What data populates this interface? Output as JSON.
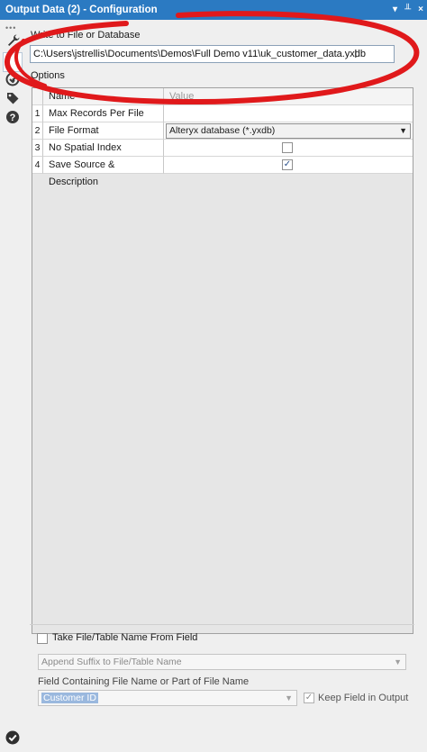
{
  "window": {
    "title": "Output Data (2) - Configuration",
    "controls": [
      "▾",
      "╨",
      "×"
    ]
  },
  "toolbar": {
    "dots": "•••",
    "icons": [
      "wrench-icon",
      "chevron-right-icon",
      "shield-check-icon",
      "tag-icon",
      "help-icon"
    ],
    "expand_glyph": "›",
    "status_icon": "ok-check-icon"
  },
  "write_section": {
    "label": "Write to File or Database",
    "path": "C:\\Users\\jstrellis\\Documents\\Demos\\Full Demo v11\\uk_customer_data.yxdb"
  },
  "options": {
    "label": "Options",
    "columns": [
      "Name",
      "Value"
    ],
    "rows": [
      {
        "num": "1",
        "name": "Max Records Per File",
        "value": ""
      },
      {
        "num": "2",
        "name": "File Format",
        "value": "Alteryx database (*.yxdb)"
      },
      {
        "num": "3",
        "name": "No Spatial Index",
        "checked": false
      },
      {
        "num": "4",
        "name": "Save Source & Description",
        "checked": true
      }
    ]
  },
  "field_section": {
    "take_name_label": "Take File/Table Name From Field",
    "take_name_checked": false,
    "append_dropdown": "Append Suffix to File/Table Name",
    "field_label": "Field Containing File Name or Part of File Name",
    "field_dropdown": "Customer ID",
    "keep_field_label": "Keep Field in Output",
    "keep_field_checked": true
  },
  "colors": {
    "titlebar": "#2b7ac2",
    "annotation": "#e0191b"
  }
}
